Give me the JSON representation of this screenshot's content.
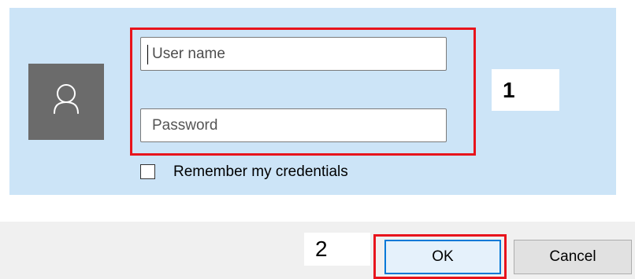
{
  "login": {
    "username_placeholder": "User name",
    "password_placeholder": "Password",
    "remember_label": "Remember my credentials",
    "remember_checked": false,
    "avatar_icon": "user-icon"
  },
  "footer": {
    "ok_label": "OK",
    "cancel_label": "Cancel"
  },
  "callouts": {
    "first": "1",
    "second": "2"
  },
  "colors": {
    "panel_background": "#cce4f7",
    "avatar_tile": "#6b6b6b",
    "highlight": "#e8141c",
    "ok_focus_border": "#0078d7"
  }
}
